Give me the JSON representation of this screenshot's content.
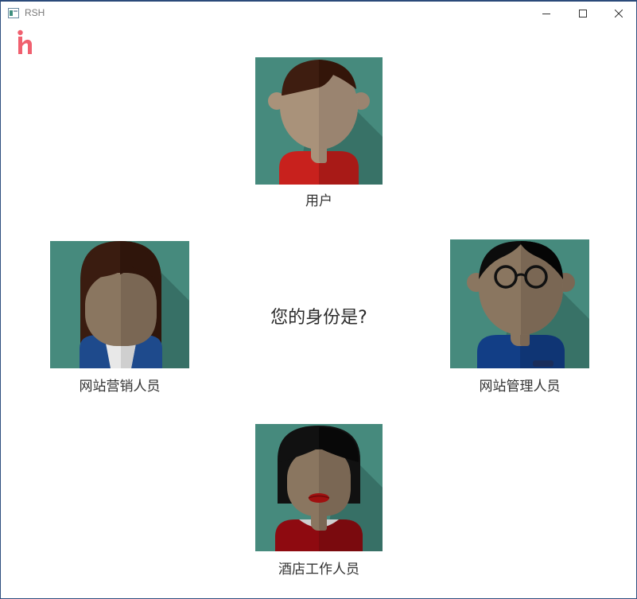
{
  "window": {
    "title": "RSH"
  },
  "logo": {
    "text": "h",
    "color": "#f0606f"
  },
  "question": "您的身份是?",
  "roles": [
    {
      "id": "user",
      "label": "用户"
    },
    {
      "id": "marketing",
      "label": "网站营销人员"
    },
    {
      "id": "admin",
      "label": "网站管理人员"
    },
    {
      "id": "hotel",
      "label": "酒店工作人员"
    }
  ],
  "colors": {
    "avatar_bg": "#3e7f73",
    "skin": "#a9927a",
    "accent_red": "#c8211d"
  }
}
